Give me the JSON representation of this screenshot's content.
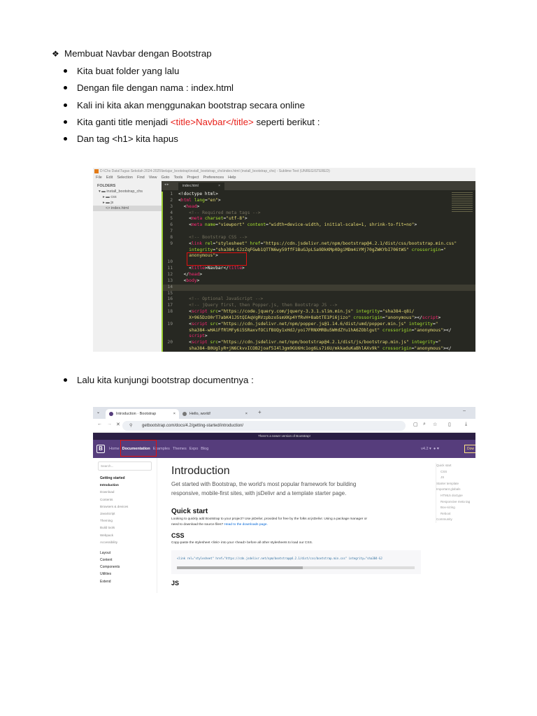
{
  "document": {
    "main_bullet": "Membuat Navbar dengan Bootstrap",
    "bullets": [
      "Kita buat folder yang lalu",
      "Dengan file dengan nama : index.html",
      "Kali ini kita akan menggunakan bootstrap secara online"
    ],
    "bullet4": {
      "pre": "Kita ganti title menjadi ",
      "code": "<title>Navbar</title>",
      "post": " seperti berikut :"
    },
    "bullet5": "Dan tag <h1> kita hapus",
    "bullet6": "Lalu kita kunjungi bootstrap documentnya :"
  },
  "sublime": {
    "title": "D:\\Chs Data\\Tugas Sekolah 2024-2025\\belajar_bootstrap\\install_bootstrap_chs\\index.html (install_bootstrap_chs) - Sublime Text (UNREGISTERED)",
    "menu": [
      "File",
      "Edit",
      "Selection",
      "Find",
      "View",
      "Goto",
      "Tools",
      "Project",
      "Preferences",
      "Help"
    ],
    "folders_label": "FOLDERS",
    "tree": [
      "install_bootstrap_chs",
      "css",
      "js",
      "index.html"
    ],
    "tab": "index.html",
    "lines": [
      {
        "n": "1",
        "s": [
          [
            "p",
            "<!doctype html>"
          ]
        ]
      },
      {
        "n": "2",
        "s": [
          [
            "p",
            "<"
          ],
          [
            "t",
            "html"
          ],
          [
            "a",
            " lang"
          ],
          [
            "p",
            "="
          ],
          [
            "s",
            "\"en\""
          ],
          [
            "p",
            ">"
          ]
        ]
      },
      {
        "n": "3",
        "s": [
          [
            "p",
            "  <"
          ],
          [
            "t",
            "head"
          ],
          [
            "p",
            ">"
          ]
        ]
      },
      {
        "n": "4",
        "s": [
          [
            "c",
            "    <!-- Required meta tags -->"
          ]
        ]
      },
      {
        "n": "5",
        "s": [
          [
            "p",
            "    <"
          ],
          [
            "t",
            "meta"
          ],
          [
            "a",
            " charset"
          ],
          [
            "p",
            "="
          ],
          [
            "s",
            "\"utf-8\""
          ],
          [
            "p",
            ">"
          ]
        ]
      },
      {
        "n": "6",
        "s": [
          [
            "p",
            "    <"
          ],
          [
            "t",
            "meta"
          ],
          [
            "a",
            " name"
          ],
          [
            "p",
            "="
          ],
          [
            "s",
            "\"viewport\""
          ],
          [
            "a",
            " content"
          ],
          [
            "p",
            "="
          ],
          [
            "s",
            "\"width=device-width, initial-scale=1, shrink-to-fit=no\""
          ],
          [
            "p",
            ">"
          ]
        ]
      },
      {
        "n": "7",
        "s": []
      },
      {
        "n": "8",
        "s": [
          [
            "c",
            "    <!-- Bootstrap CSS -->"
          ]
        ]
      },
      {
        "n": "9",
        "s": [
          [
            "p",
            "    <"
          ],
          [
            "t",
            "link"
          ],
          [
            "a",
            " rel"
          ],
          [
            "p",
            "="
          ],
          [
            "s",
            "\"stylesheet\""
          ],
          [
            "a",
            " href"
          ],
          [
            "p",
            "="
          ],
          [
            "s",
            "\"https://cdn.jsdelivr.net/npm/bootstrap@4.2.1/dist/css/bootstrap.min.css\""
          ]
        ]
      },
      {
        "n": "",
        "s": [
          [
            "a",
            "    integrity"
          ],
          [
            "p",
            "="
          ],
          [
            "s",
            "\"sha384-GJzZqFGwb1QTTN6wy59ffF1BuGJpLSa9DkKMp0DgiMDm4iYMj70gZWKYbI706tWS\""
          ],
          [
            "a",
            " crossorigin"
          ],
          [
            "p",
            "="
          ],
          [
            "s",
            "\""
          ]
        ]
      },
      {
        "n": "",
        "s": [
          [
            "s",
            "    anonymous\""
          ],
          [
            "p",
            ">"
          ]
        ]
      },
      {
        "n": "10",
        "s": []
      },
      {
        "n": "11",
        "s": [
          [
            "p",
            "    <"
          ],
          [
            "t",
            "title"
          ],
          [
            "p",
            ">Navbar</"
          ],
          [
            "t",
            "title"
          ],
          [
            "p",
            ">"
          ]
        ]
      },
      {
        "n": "12",
        "s": [
          [
            "p",
            "  </"
          ],
          [
            "t",
            "head"
          ],
          [
            "p",
            ">"
          ]
        ]
      },
      {
        "n": "13",
        "s": [
          [
            "p",
            "  <"
          ],
          [
            "t",
            "body"
          ],
          [
            "p",
            ">"
          ]
        ]
      },
      {
        "n": "14",
        "s": []
      },
      {
        "n": "15",
        "s": []
      },
      {
        "n": "16",
        "s": [
          [
            "c",
            "    <!-- Optional JavaScript -->"
          ]
        ]
      },
      {
        "n": "17",
        "s": [
          [
            "c",
            "    <!-- jQuery first, then Popper.js, then Bootstrap JS -->"
          ]
        ]
      },
      {
        "n": "18",
        "s": [
          [
            "p",
            "    <"
          ],
          [
            "t",
            "script"
          ],
          [
            "a",
            " src"
          ],
          [
            "p",
            "="
          ],
          [
            "s",
            "\"https://code.jquery.com/jquery-3.3.1.slim.min.js\""
          ],
          [
            "a",
            " integrity"
          ],
          [
            "p",
            "="
          ],
          [
            "s",
            "\"sha384-q8i/"
          ]
        ]
      },
      {
        "n": "",
        "s": [
          [
            "s",
            "    X+965DzO0rT7abK41JStQIAqVgRVzpbzo5smXKp4YfRvH+8abtTE1Pi6jizo\""
          ],
          [
            "a",
            " crossorigin"
          ],
          [
            "p",
            "="
          ],
          [
            "s",
            "\"anonymous\""
          ],
          [
            "p",
            "></"
          ],
          [
            "t",
            "script"
          ],
          [
            "p",
            ">"
          ]
        ]
      },
      {
        "n": "19",
        "s": [
          [
            "p",
            "    <"
          ],
          [
            "t",
            "script"
          ],
          [
            "a",
            " src"
          ],
          [
            "p",
            "="
          ],
          [
            "s",
            "\"https://cdn.jsdelivr.net/npm/popper.js@1.14.6/dist/umd/popper.min.js\""
          ],
          [
            "a",
            " integrity"
          ],
          [
            "p",
            "="
          ],
          [
            "s",
            "\""
          ]
        ]
      },
      {
        "n": "",
        "s": [
          [
            "s",
            "    sha384-wHAiFfRlMFy6i5SRaxvfOCifBUQy1xHdJ/yoi7FRNXMRBu5WHdZYu1hA6ZOblgut\""
          ],
          [
            "a",
            " crossorigin"
          ],
          [
            "p",
            "="
          ],
          [
            "s",
            "\"anonymous\""
          ],
          [
            "p",
            "></"
          ]
        ]
      },
      {
        "n": "",
        "s": [
          [
            "t",
            "    script"
          ],
          [
            "p",
            ">"
          ]
        ]
      },
      {
        "n": "20",
        "s": [
          [
            "p",
            "    <"
          ],
          [
            "t",
            "script"
          ],
          [
            "a",
            " src"
          ],
          [
            "p",
            "="
          ],
          [
            "s",
            "\"https://cdn.jsdelivr.net/npm/bootstrap@4.2.1/dist/js/bootstrap.min.js\""
          ],
          [
            "a",
            " integrity"
          ],
          [
            "p",
            "="
          ],
          [
            "s",
            "\""
          ]
        ]
      },
      {
        "n": "",
        "s": [
          [
            "s",
            "    sha384-B0UglyR+jN6CkvvICOB2joaf5I4l3gm9GU6Hc1og6Ls7i6U/mkkaduKaBhlAXv9k\""
          ],
          [
            "a",
            " crossorigin"
          ],
          [
            "p",
            "="
          ],
          [
            "s",
            "\"anonymous\""
          ],
          [
            "p",
            "></"
          ]
        ]
      },
      {
        "n": "",
        "s": [
          [
            "t",
            "    script"
          ],
          [
            "p",
            ">"
          ]
        ]
      },
      {
        "n": "21",
        "s": [
          [
            "p",
            "  </"
          ],
          [
            "t",
            "body"
          ],
          [
            "p",
            ">"
          ]
        ]
      },
      {
        "n": "22",
        "s": [
          [
            "p",
            "</"
          ],
          [
            "t",
            "html"
          ],
          [
            "p",
            ">"
          ]
        ]
      }
    ]
  },
  "browser": {
    "tabs": [
      "Introduction · Bootstrap",
      "Hello, world!"
    ],
    "url": "getbootstrap.com/docs/4.2/getting-started/introduction/",
    "banner": "There's a newer version of Bootstrap!",
    "nav": {
      "logo": "B",
      "items": [
        "Home",
        "Documentation",
        "Examples",
        "Themes",
        "Expo",
        "Blog"
      ],
      "version": "v4.2 ▾",
      "download": "Dow"
    },
    "search_placeholder": "Search...",
    "sidebar": {
      "heading": "Getting started",
      "items": [
        "Introduction",
        "Download",
        "Contents",
        "Browsers & devices",
        "JavaScript",
        "Theming",
        "Build tools",
        "Webpack",
        "Accessibility"
      ],
      "groups": [
        "Layout",
        "Content",
        "Components",
        "Utilities",
        "Extend"
      ]
    },
    "content": {
      "title": "Introduction",
      "lead": "Get started with Bootstrap, the world's most popular framework for building responsive, mobile-first sites, with jsDelivr and a template starter page.",
      "quick_start": "Quick start",
      "quick_text": "Looking to quickly add Bootstrap to your project? Use jsDelivr, provided for free by the folks at jsDelivr. Using a package manager or need to download the source files? ",
      "quick_link": "Head to the downloads page.",
      "css_heading": "CSS",
      "css_text": "Copy-paste the stylesheet <link> into your <head> before all other stylesheets to load our CSS.",
      "snippet": "<link rel=\"stylesheet\" href=\"https://cdn.jsdelivr.net/npm/bootstrap@4.2.1/dist/css/bootstrap.min.css\" integrity=\"sha384-GJ",
      "js_heading": "JS"
    },
    "toc": [
      [
        "Quick start",
        0
      ],
      [
        "CSS",
        1
      ],
      [
        "JS",
        1
      ],
      [
        "Starter template",
        0
      ],
      [
        "Important globals",
        0
      ],
      [
        "HTML5 doctype",
        1
      ],
      [
        "Responsive meta tag",
        1
      ],
      [
        "Box-sizing",
        1
      ],
      [
        "Reboot",
        1
      ],
      [
        "Community",
        0
      ]
    ],
    "colors": {
      "navbar": "#563d7c",
      "highlight": "#e01010"
    }
  }
}
